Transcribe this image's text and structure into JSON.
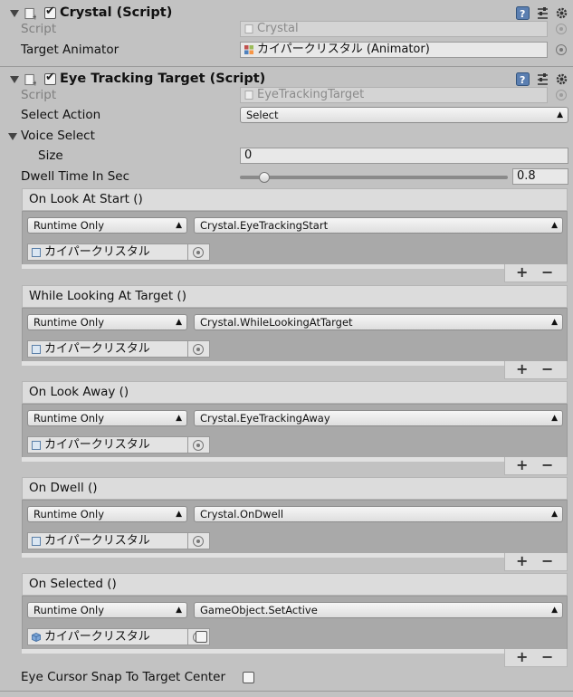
{
  "crystal": {
    "title": "Crystal (Script)",
    "script_label": "Script",
    "script_value": "Crystal",
    "target_animator_label": "Target Animator",
    "target_animator_value": "カイパークリスタル (Animator)"
  },
  "eye": {
    "title": "Eye Tracking Target (Script)",
    "script_label": "Script",
    "script_value": "EyeTrackingTarget",
    "select_action_label": "Select Action",
    "select_action_value": "Select",
    "voice_select_label": "Voice Select",
    "size_label": "Size",
    "size_value": "0",
    "dwell_label": "Dwell Time In Sec",
    "dwell_value": "0.8",
    "dwell_slider_fraction": 0.09,
    "snap_label": "Eye Cursor Snap To Target Center"
  },
  "events": [
    {
      "title": "On Look At Start ()",
      "mode": "Runtime Only",
      "func": "Crystal.EyeTrackingStart",
      "target": "カイパークリスタル",
      "show_checkbox": false
    },
    {
      "title": "While Looking At Target ()",
      "mode": "Runtime Only",
      "func": "Crystal.WhileLookingAtTarget",
      "target": "カイパークリスタル",
      "show_checkbox": false
    },
    {
      "title": "On Look Away ()",
      "mode": "Runtime Only",
      "func": "Crystal.EyeTrackingAway",
      "target": "カイパークリスタル",
      "show_checkbox": false
    },
    {
      "title": "On Dwell ()",
      "mode": "Runtime Only",
      "func": "Crystal.OnDwell",
      "target": "カイパークリスタル",
      "show_checkbox": false
    },
    {
      "title": "On Selected ()",
      "mode": "Runtime Only",
      "func": "GameObject.SetActive",
      "target": "カイパークリスタル",
      "show_checkbox": true
    }
  ],
  "controls": {
    "plus": "+",
    "minus": "−"
  },
  "colors": {
    "help_icon": "#5b7fb1",
    "panel_bg": "#c2c2c2",
    "event_body": "#a9a9a9"
  }
}
